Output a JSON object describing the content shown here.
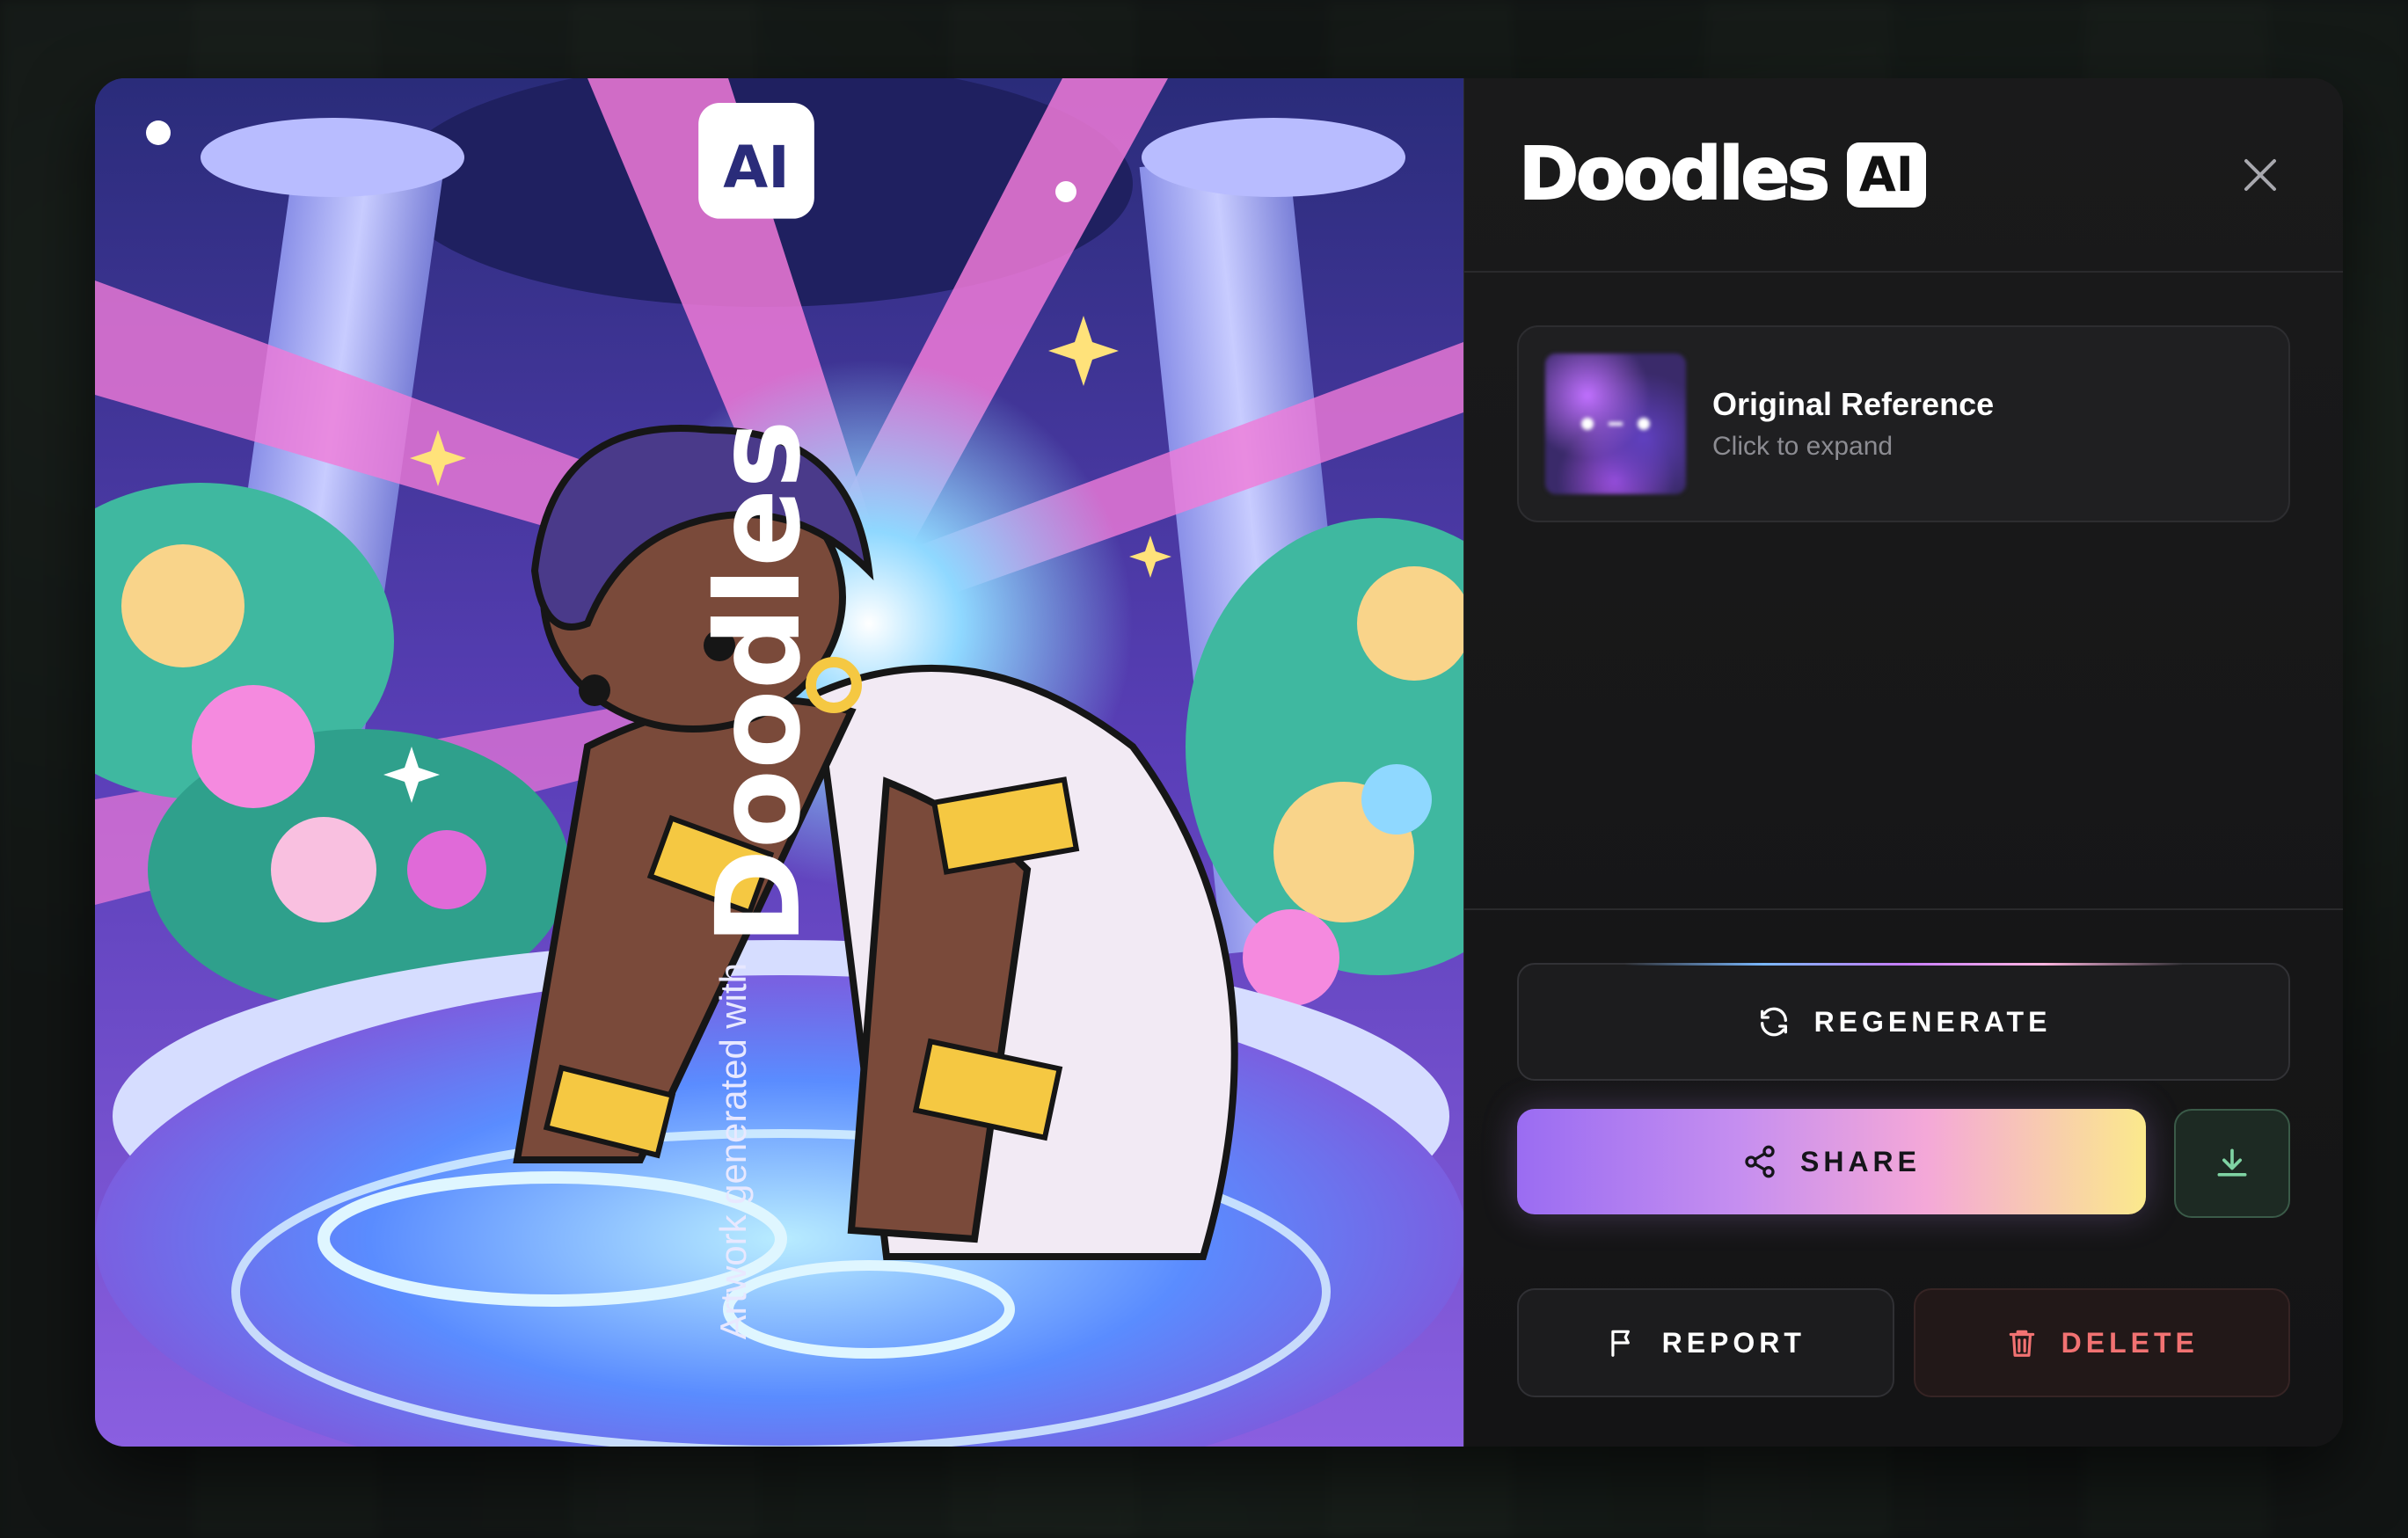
{
  "brand": {
    "name": "Doodles",
    "badge": "AI"
  },
  "watermark": {
    "prefix": "Artwork generated with",
    "brand": "Doodles"
  },
  "reference": {
    "title": "Original Reference",
    "subtitle": "Click to expand"
  },
  "actions": {
    "regenerate": "REGENERATE",
    "share": "SHARE",
    "report": "REPORT",
    "delete": "DELETE"
  },
  "icons": {
    "close": "close-icon",
    "regenerate": "refresh-icon",
    "share": "share-icon",
    "download": "download-icon",
    "report": "flag-icon",
    "delete": "trash-icon"
  },
  "colors": {
    "accent_gradient_start": "#9a6cf2",
    "accent_gradient_end": "#fbe98c",
    "delete": "#f27272",
    "download_icon": "#7fd3a3"
  }
}
